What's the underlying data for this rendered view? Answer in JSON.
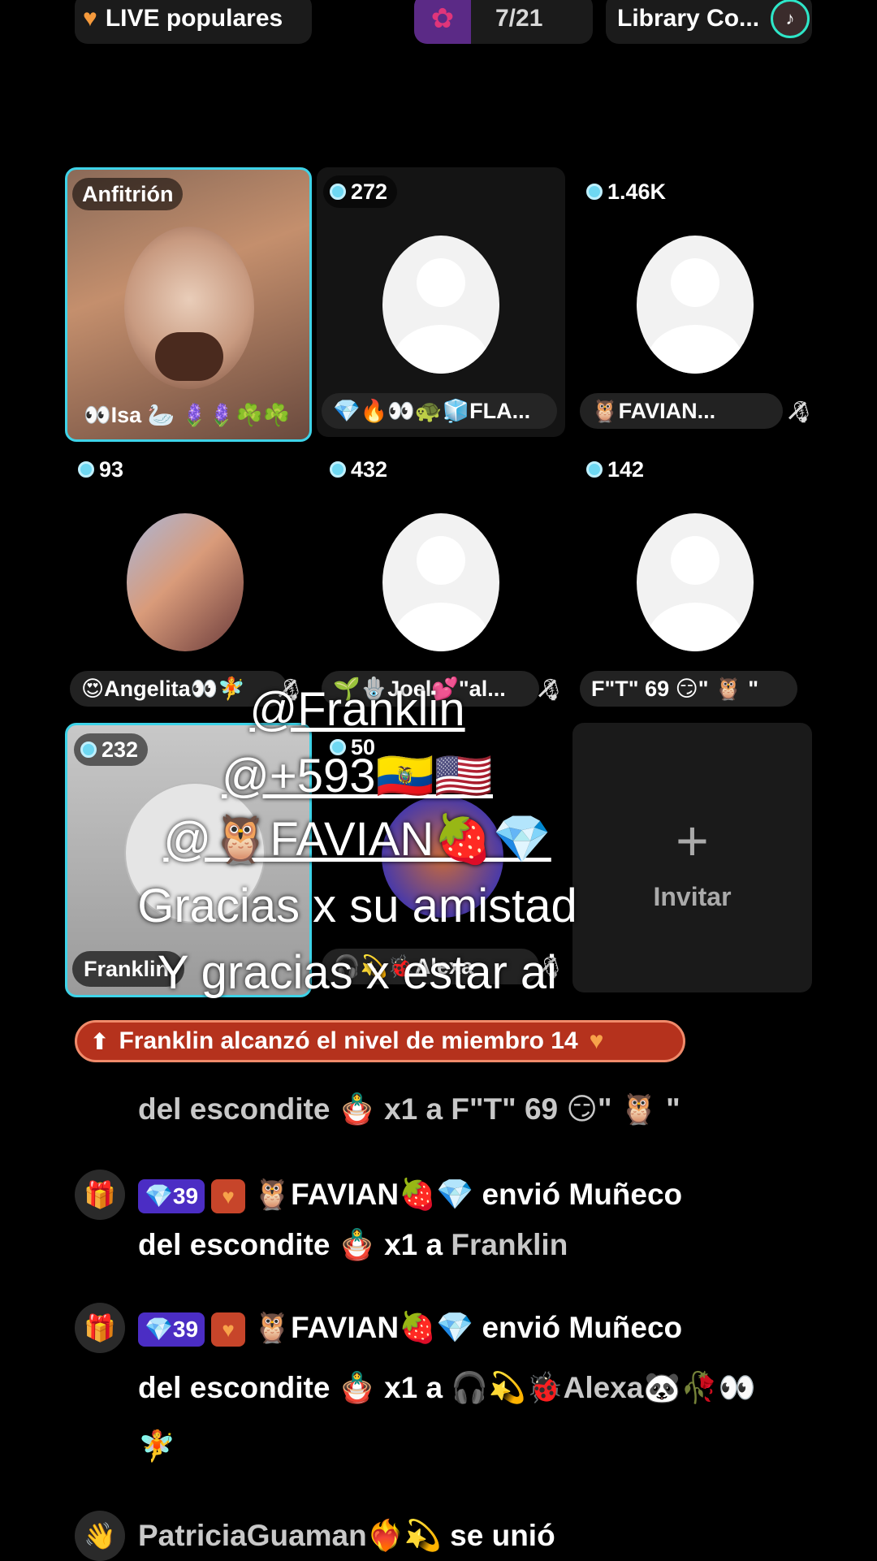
{
  "topbar": {
    "live_label": "LIVE populares",
    "rank": "7/21",
    "library_label": "Library Co..."
  },
  "tiles": {
    "host": {
      "badge": "Anfitrión",
      "name": "👀Isa 🦢 🪻🪻☘️☘️"
    },
    "t2": {
      "coins": "272",
      "name": "💎🔥👀🐢🧊FLA..."
    },
    "t3": {
      "coins": "1.46K",
      "name": "🦉FAVIAN..."
    },
    "t4": {
      "coins": "93",
      "name": "😍Angelita👀🧚"
    },
    "t5": {
      "coins": "432",
      "name": "🌱🪬Joel💕\"al..."
    },
    "t6": {
      "coins": "142",
      "name": "F\"T\" 69 😏\" 🦉 \""
    },
    "t7": {
      "coins": "232",
      "name": "Franklin"
    },
    "t8": {
      "coins": "50",
      "name": "🎧💫🐞Alexa"
    },
    "invite": {
      "label": "Invitar"
    }
  },
  "overlay": {
    "line1": "@Franklin",
    "line2": "@+593🇪🇨🇺🇸",
    "line3": "@🦉FAVIAN🍓💎",
    "line4": "Gracias x su amistad",
    "line5": "Y gracias x estar ai"
  },
  "banner": {
    "text": "Franklin alcanzó el nivel de miembro 14"
  },
  "chat": {
    "m0_line": "del escondite 🪆 x1 a F\"T\" 69 😏\" 🦉 \"",
    "m1_level": "39",
    "m1_sender": "🦉FAVIAN🍓💎",
    "m1_action": "envió Muñeco",
    "m1_line2_a": "del escondite 🪆 x1 a",
    "m1_line2_b": "Franklin",
    "m2_level": "39",
    "m2_sender": "🦉FAVIAN🍓💎",
    "m2_action": "envió Muñeco",
    "m2_line2_a": "del escondite 🪆 x1 a",
    "m2_line2_b": "🎧💫🐞Alexa🐼🥀👀",
    "m2_line3": "🧚",
    "m3_user": "PatriciaGuaman❤️‍🔥💫",
    "m3_action": "se unió"
  }
}
